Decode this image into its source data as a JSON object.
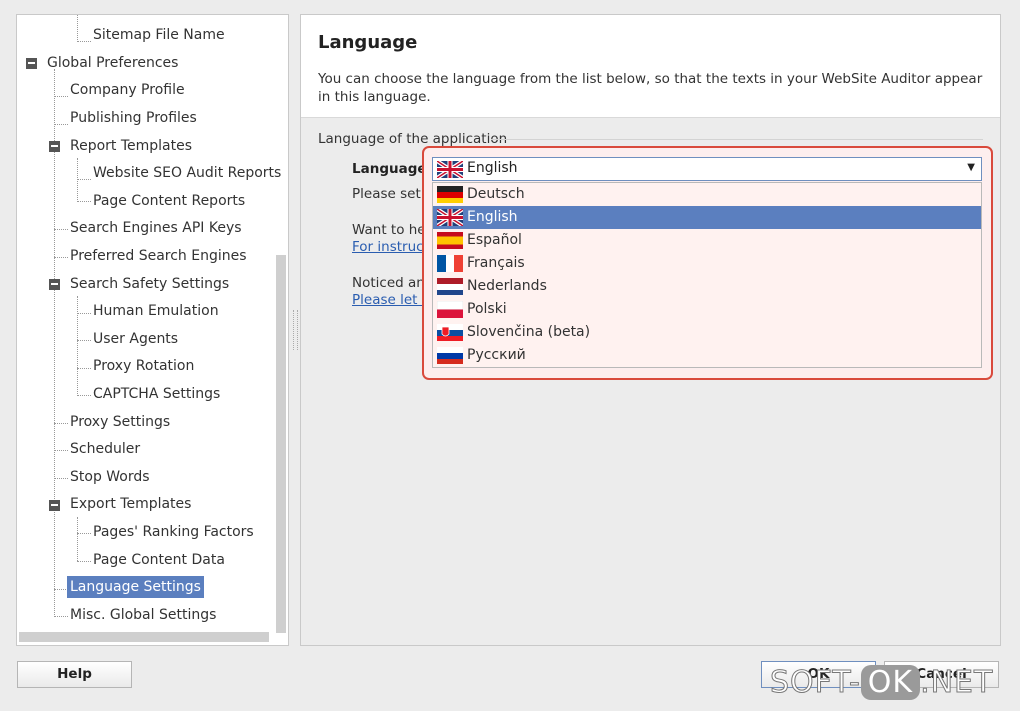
{
  "tree": {
    "items": [
      {
        "label": "Sitemap File Name",
        "level": 3
      },
      {
        "label": "Global Preferences",
        "level": 1,
        "expander": true
      },
      {
        "label": "Company Profile",
        "level": 2
      },
      {
        "label": "Publishing Profiles",
        "level": 2
      },
      {
        "label": "Report Templates",
        "level": 2,
        "expander": true
      },
      {
        "label": "Website SEO Audit Reports",
        "level": 3
      },
      {
        "label": "Page Content Reports",
        "level": 3
      },
      {
        "label": "Search Engines API Keys",
        "level": 2
      },
      {
        "label": "Preferred Search Engines",
        "level": 2
      },
      {
        "label": "Search Safety Settings",
        "level": 2,
        "expander": true
      },
      {
        "label": "Human Emulation",
        "level": 3
      },
      {
        "label": "User Agents",
        "level": 3
      },
      {
        "label": "Proxy Rotation",
        "level": 3
      },
      {
        "label": "CAPTCHA Settings",
        "level": 3
      },
      {
        "label": "Proxy Settings",
        "level": 2
      },
      {
        "label": "Scheduler",
        "level": 2
      },
      {
        "label": "Stop Words",
        "level": 2
      },
      {
        "label": "Export Templates",
        "level": 2,
        "expander": true
      },
      {
        "label": "Pages' Ranking Factors",
        "level": 3
      },
      {
        "label": "Page Content Data",
        "level": 3
      },
      {
        "label": "Language Settings",
        "level": 2,
        "selected": true
      },
      {
        "label": "Misc. Global Settings",
        "level": 2
      }
    ]
  },
  "content": {
    "title": "Language",
    "description": "You can choose the language from the list below, so that the texts in your WebSite Auditor appear in this language.",
    "group_label": "Language of the application",
    "language_label": "Language:",
    "please_set": "Please set th",
    "want_help": "Want to help",
    "for_instructions": "For instructio",
    "noticed": "Noticed an e",
    "please_let": "Please let us"
  },
  "combo": {
    "selected": "English",
    "selected_flag": "uk-flag-icon"
  },
  "options": [
    {
      "label": "Deutsch",
      "flag": "de-flag-icon"
    },
    {
      "label": "English",
      "flag": "uk-flag-icon",
      "selected": true
    },
    {
      "label": "Español",
      "flag": "es-flag-icon"
    },
    {
      "label": "Français",
      "flag": "fr-flag-icon"
    },
    {
      "label": "Nederlands",
      "flag": "nl-flag-icon"
    },
    {
      "label": "Polski",
      "flag": "pl-flag-icon"
    },
    {
      "label": "Slovenčina (beta)",
      "flag": "sk-flag-icon"
    },
    {
      "label": "Русский",
      "flag": "ru-flag-icon"
    }
  ],
  "buttons": {
    "help": "Help",
    "ok": "OK",
    "cancel": "Cancel"
  },
  "watermark": {
    "left": "SOFT-",
    "box": "OK",
    "right": ".NET"
  },
  "colors": {
    "selection": "#5b7fbf",
    "highlight_border": "#d94a3c",
    "link": "#2a5db0"
  }
}
